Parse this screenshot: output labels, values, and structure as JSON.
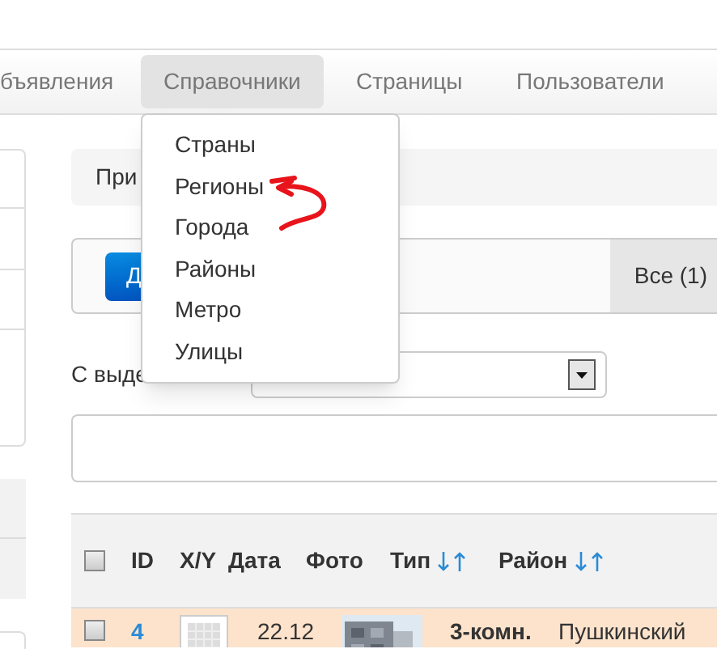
{
  "navbar": {
    "items": [
      {
        "label": "бъявления",
        "selected": false
      },
      {
        "label": "Справочники",
        "selected": true
      },
      {
        "label": "Страницы",
        "selected": false
      },
      {
        "label": "Пользователи",
        "selected": false
      }
    ]
  },
  "dropdown_menu": {
    "items": [
      "Страны",
      "Регионы",
      "Города",
      "Районы",
      "Метро",
      "Улицы"
    ]
  },
  "breadcrumb": "При",
  "toolbar": {
    "button": "Д",
    "tabs": [
      {
        "label": "Все (1)",
        "selected": true
      }
    ]
  },
  "bulk_action": {
    "label": "С выде"
  },
  "table": {
    "select_all": {
      "checked": false
    },
    "columns": [
      {
        "label": "ID",
        "kind": "plain"
      },
      {
        "label": "X/Y",
        "kind": "plain"
      },
      {
        "label": "Дата",
        "kind": "plain"
      },
      {
        "label": "Фото",
        "kind": "plain"
      },
      {
        "label": "Тип",
        "kind": "sortable"
      },
      {
        "label": "Район",
        "kind": "sortable"
      }
    ],
    "rows": [
      {
        "checked": false,
        "id": "4",
        "date": "22.12",
        "type": "3-комн.",
        "district": "Пушкинский"
      }
    ]
  }
}
